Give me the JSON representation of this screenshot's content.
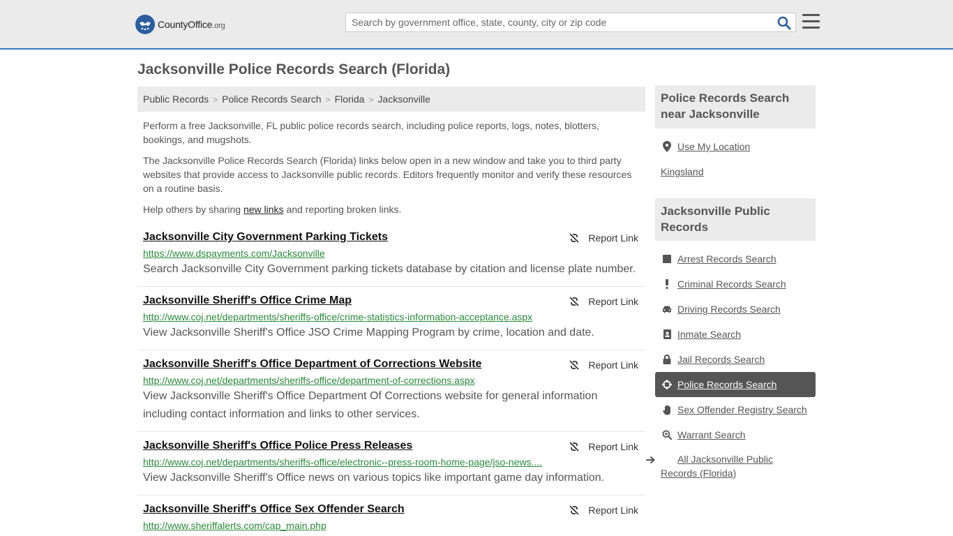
{
  "header": {
    "logo_name": "CountyOffice",
    "logo_tld": ".org",
    "search_placeholder": "Search by government office, state, county, city or zip code"
  },
  "page_title": "Jacksonville Police Records Search (Florida)",
  "breadcrumb": [
    "Public Records",
    "Police Records Search",
    "Florida",
    "Jacksonville"
  ],
  "intro": {
    "p1": "Perform a free Jacksonville, FL public police records search, including police reports, logs, notes, blotters, bookings, and mugshots.",
    "p2": "The Jacksonville Police Records Search (Florida) links below open in a new window and take you to third party websites that provide access to Jacksonville public records. Editors frequently monitor and verify these resources on a routine basis.",
    "p3_before": "Help others by sharing ",
    "p3_link": "new links",
    "p3_after": " and reporting broken links."
  },
  "report_label": "Report Link",
  "results": [
    {
      "title": "Jacksonville City Government Parking Tickets",
      "url": "https://www.dspayments.com/Jacksonville",
      "desc": "Search Jacksonville City Government parking tickets database by citation and license plate number."
    },
    {
      "title": "Jacksonville Sheriff's Office Crime Map",
      "url": "http://www.coj.net/departments/sheriffs-office/crime-statistics-information-acceptance.aspx",
      "desc": "View Jacksonville Sheriff's Office JSO Crime Mapping Program by crime, location and date."
    },
    {
      "title": "Jacksonville Sheriff's Office Department of Corrections Website",
      "url": "http://www.coj.net/departments/sheriffs-office/department-of-corrections.aspx",
      "desc": "View Jacksonville Sheriff's Office Department Of Corrections website for general information including contact information and links to other services."
    },
    {
      "title": "Jacksonville Sheriff's Office Police Press Releases",
      "url": "http://www.coj.net/departments/sheriffs-office/electronic--press-room-home-page/jso-news....",
      "desc": "View Jacksonville Sheriff's Office news on various topics like important game day information."
    },
    {
      "title": "Jacksonville Sheriff's Office Sex Offender Search",
      "url": "http://www.sheriffalerts.com/cap_main.php",
      "desc": ""
    }
  ],
  "sidebar": {
    "near_heading": "Police Records Search near Jacksonville",
    "use_location": "Use My Location",
    "nearby": [
      "Kingsland"
    ],
    "public_heading": "Jacksonville Public Records",
    "links": [
      {
        "label": "Arrest Records Search",
        "icon": "square-icon"
      },
      {
        "label": "Criminal Records Search",
        "icon": "exclamation-icon"
      },
      {
        "label": "Driving Records Search",
        "icon": "car-icon"
      },
      {
        "label": "Inmate Search",
        "icon": "id-badge-icon"
      },
      {
        "label": "Jail Records Search",
        "icon": "lock-icon"
      },
      {
        "label": "Police Records Search",
        "icon": "crosshairs-icon"
      },
      {
        "label": "Sex Offender Registry Search",
        "icon": "hand-icon"
      },
      {
        "label": "Warrant Search",
        "icon": "magnify-icon"
      }
    ],
    "all_link": "All Jacksonville Public Records (Florida)"
  }
}
